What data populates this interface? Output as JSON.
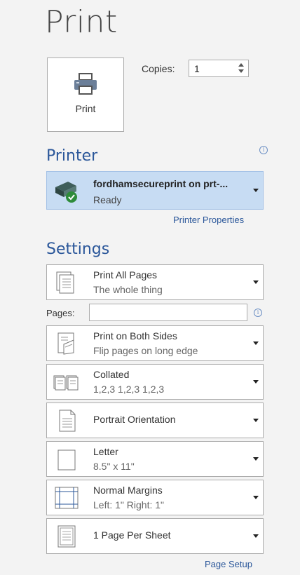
{
  "page": {
    "title": "Print"
  },
  "print_button": {
    "label": "Print",
    "icon": "printer-icon"
  },
  "copies": {
    "label": "Copies:",
    "value": "1"
  },
  "printer": {
    "heading": "Printer",
    "name": "fordhamsecureprint on prt-...",
    "status": "Ready",
    "properties_link": "Printer Properties"
  },
  "settings": {
    "heading": "Settings",
    "pages_label": "Pages:",
    "pages_value": "",
    "items": [
      {
        "line1": "Print All Pages",
        "line2": "The whole thing",
        "icon": "pages-stack-icon"
      },
      {
        "line1": "Print on Both Sides",
        "line2": "Flip pages on long edge",
        "icon": "duplex-icon"
      },
      {
        "line1": "Collated",
        "line2": "1,2,3    1,2,3    1,2,3",
        "icon": "collated-icon"
      },
      {
        "line1": "Portrait Orientation",
        "line2": "",
        "icon": "portrait-icon"
      },
      {
        "line1": "Letter",
        "line2": "8.5\" x 11\"",
        "icon": "paper-size-icon"
      },
      {
        "line1": "Normal Margins",
        "line2": "Left:  1\"   Right:  1\"",
        "icon": "margins-icon"
      },
      {
        "line1": "1 Page Per Sheet",
        "line2": "",
        "icon": "pages-per-sheet-icon"
      }
    ],
    "page_setup_link": "Page Setup"
  },
  "colors": {
    "accent": "#2b579a",
    "selected": "#c7dcf3",
    "background": "#f3f3f3"
  }
}
